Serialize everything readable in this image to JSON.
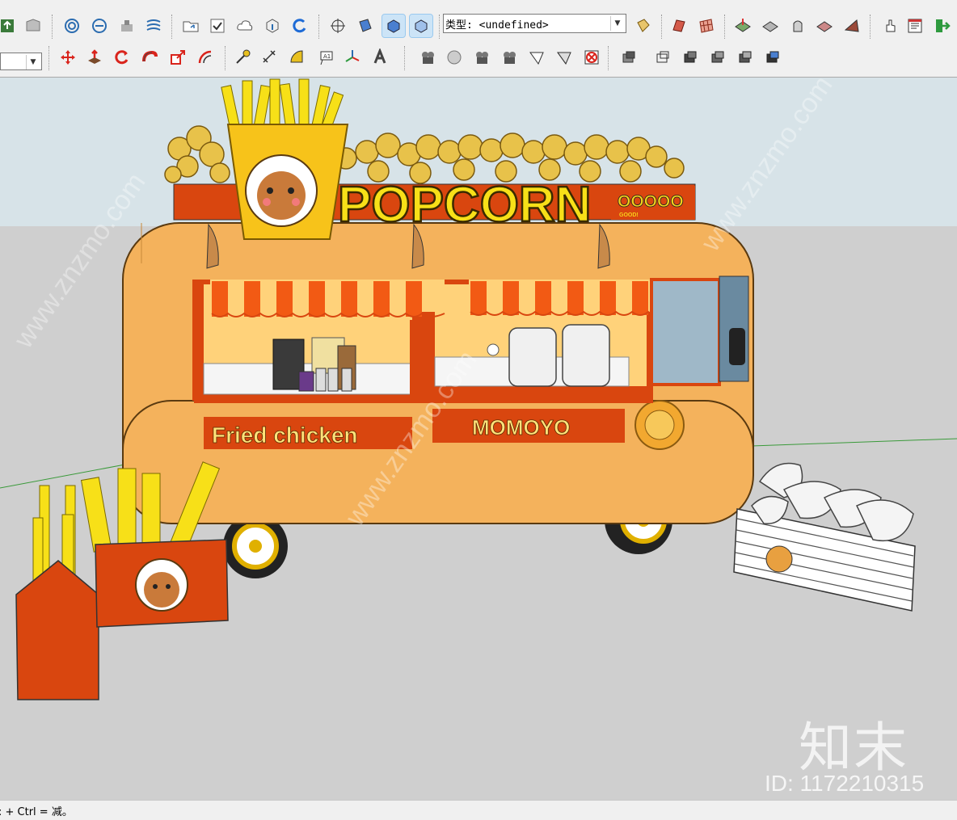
{
  "toolbar": {
    "type_label": "类型: <undefined>",
    "groups_row1": [
      {
        "name": "tb-group-warehouse",
        "icons": [
          "upload-icon",
          "warehouse-icon"
        ]
      },
      {
        "name": "tb-group-sandbox",
        "icons": [
          "sandbox-contours-icon",
          "sandbox-scratch-icon",
          "stamp-icon",
          "drape-icon"
        ]
      },
      {
        "name": "tb-group-ext",
        "icons": [
          "open-folder-icon",
          "checkbox-icon",
          "cloud-icon",
          "share-component-icon",
          "refresh-icon"
        ]
      },
      {
        "name": "tb-group-styles",
        "icons": [
          "position-camera-icon",
          "style-back-icon",
          "style-pressed-icon",
          "style-front-icon"
        ]
      }
    ]
  },
  "viewport": {
    "signs": {
      "popcorn": "POPCORN",
      "good_badge": "OOOOO",
      "good_small": "GOOD!",
      "fried_chicken": "Fried chicken",
      "momoyo": "MOMOYO"
    }
  },
  "watermark": {
    "brand": "知末",
    "id": "ID: 1172210315",
    "site": "www.znzmo.com"
  },
  "status_bar": {
    "text": ": + Ctrl = 减。"
  },
  "colors": {
    "truck_body": "#f4b25c",
    "trim_orange": "#e8500e",
    "awning_yellow": "#ffd27a",
    "fries_yellow": "#f7e018",
    "box_red": "#d9460f",
    "sky": "#d7e3e8",
    "ground": "#cfcfcf"
  }
}
